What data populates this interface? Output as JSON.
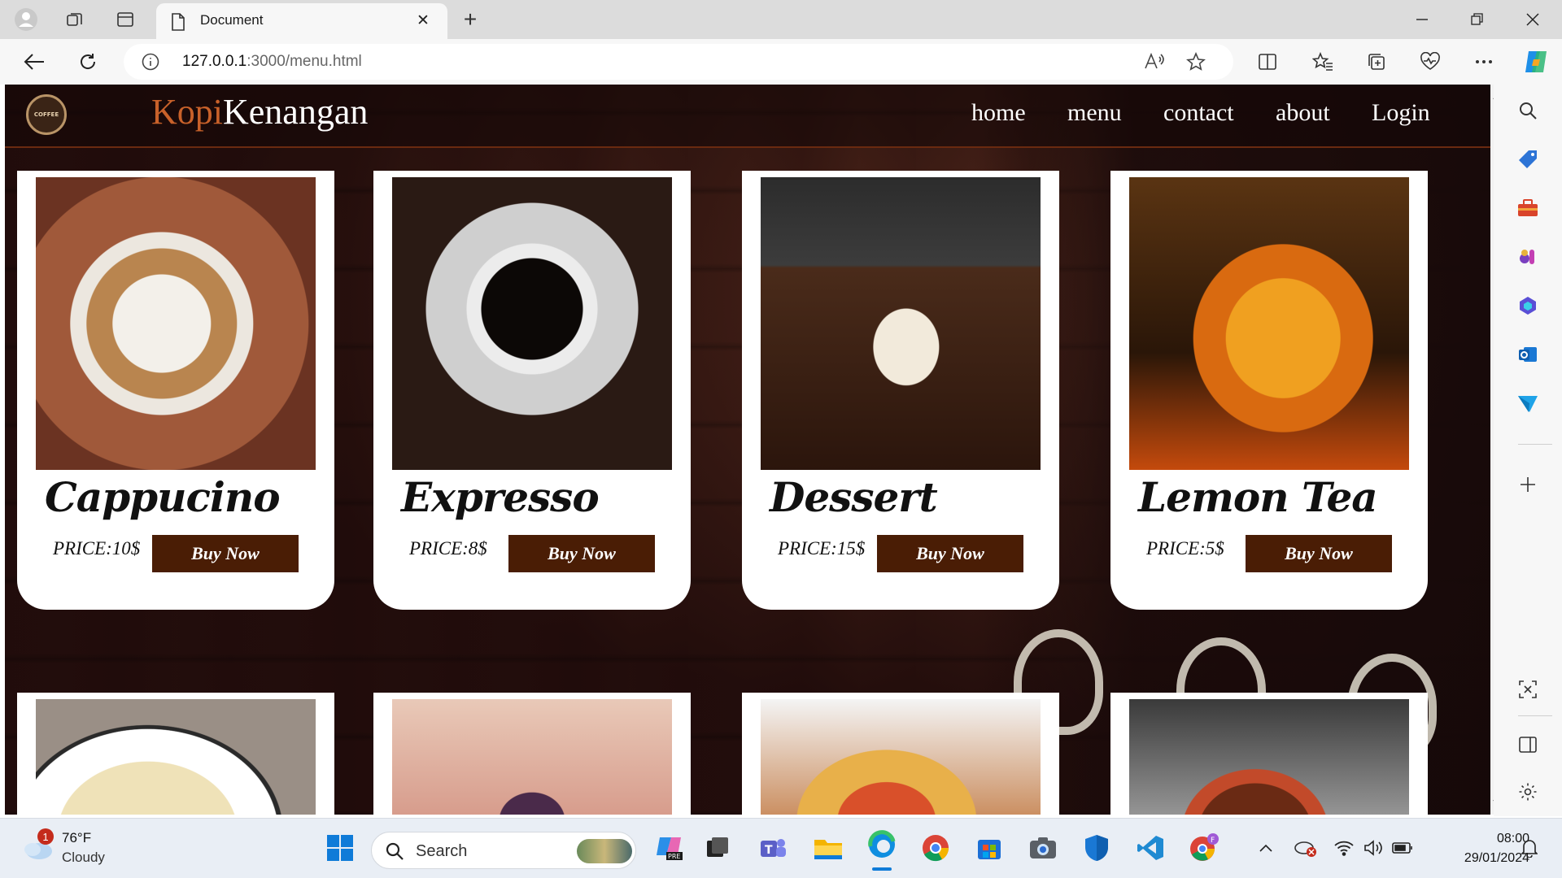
{
  "browser": {
    "tab_title": "Document",
    "url_host": "127.0.0.1",
    "url_rest": ":3000/menu.html",
    "tab_close": "✕",
    "new_tab": "+"
  },
  "site": {
    "brand_part1": "Kopi",
    "brand_part2": "Kenangan",
    "logo_text": "COFFEE",
    "nav": [
      "home",
      "menu",
      "contact",
      "about",
      "Login"
    ]
  },
  "menu_items": [
    {
      "name": "Cappucino",
      "price": "PRICE:10$",
      "button": "Buy Now"
    },
    {
      "name": "Expresso",
      "price": "PRICE:8$",
      "button": "Buy Now"
    },
    {
      "name": "Dessert",
      "price": "PRICE:15$",
      "button": "Buy Now"
    },
    {
      "name": "Lemon Tea",
      "price": "PRICE:5$",
      "button": "Buy Now"
    }
  ],
  "taskbar": {
    "weather_temp": "76°F",
    "weather_desc": "Cloudy",
    "weather_badge": "1",
    "search_label": "Search",
    "time": "08:00",
    "date": "29/01/2024"
  },
  "colors": {
    "brand_accent": "#c8612a",
    "button_bg": "#4a1d05",
    "header_border": "#6a2a10"
  }
}
